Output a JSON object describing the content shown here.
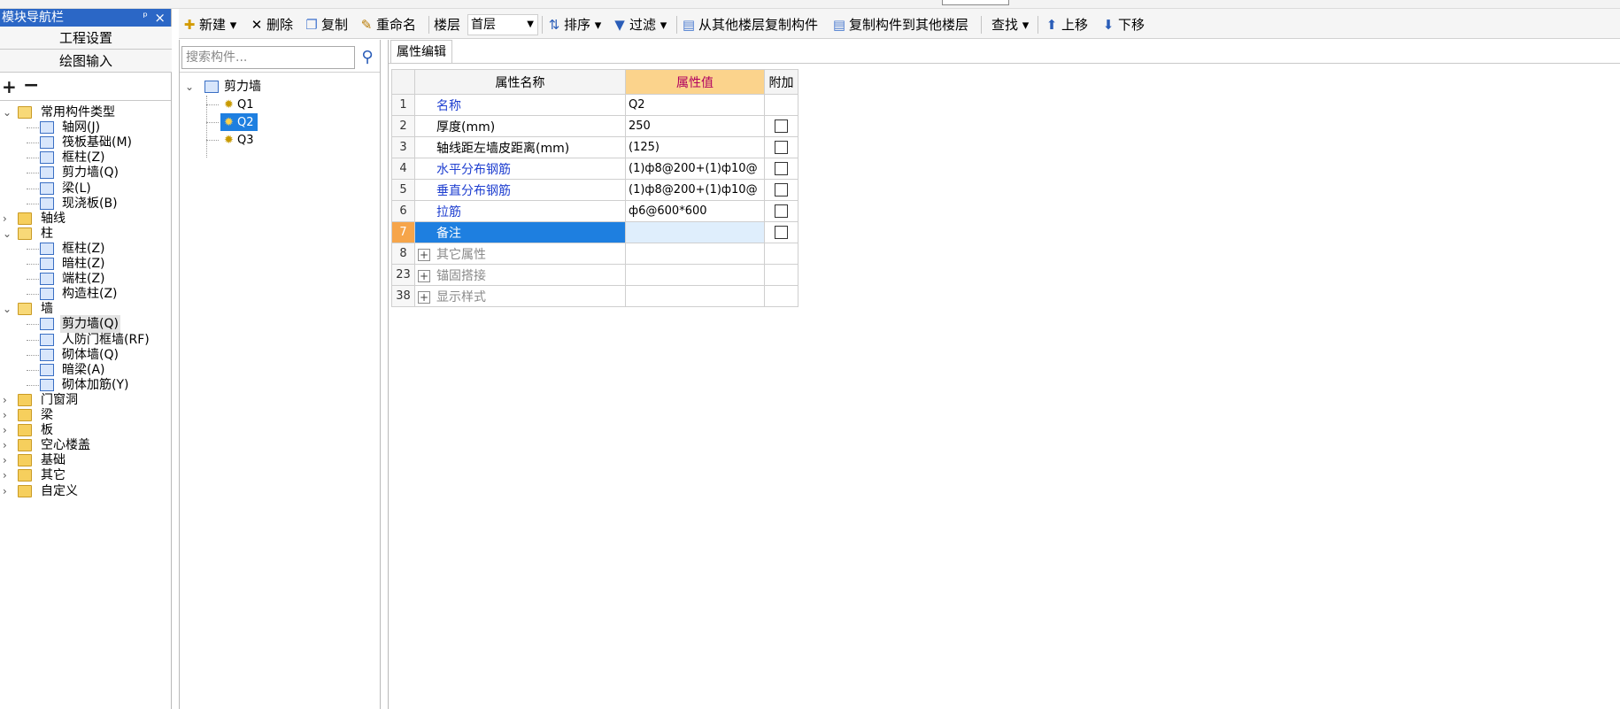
{
  "nav": {
    "title": "模块导航栏",
    "pin_icon": "pin-icon",
    "close_icon": "close-icon",
    "project_settings": "工程设置",
    "drawing_input": "绘图输入",
    "tree": [
      {
        "label": "常用构件类型",
        "type": "folder",
        "expanded": true
      },
      {
        "label": "轴网(J)",
        "type": "component"
      },
      {
        "label": "筏板基础(M)",
        "type": "component"
      },
      {
        "label": "框柱(Z)",
        "type": "component"
      },
      {
        "label": "剪力墙(Q)",
        "type": "component"
      },
      {
        "label": "梁(L)",
        "type": "component"
      },
      {
        "label": "现浇板(B)",
        "type": "component"
      },
      {
        "label": "轴线",
        "type": "folder",
        "expanded": false
      },
      {
        "label": "柱",
        "type": "folder",
        "expanded": true
      },
      {
        "label": "框柱(Z)",
        "type": "component"
      },
      {
        "label": "暗柱(Z)",
        "type": "component"
      },
      {
        "label": "端柱(Z)",
        "type": "component"
      },
      {
        "label": "构造柱(Z)",
        "type": "component"
      },
      {
        "label": "墙",
        "type": "folder",
        "expanded": true
      },
      {
        "label": "剪力墙(Q)",
        "type": "component",
        "selected": true
      },
      {
        "label": "人防门框墙(RF)",
        "type": "component"
      },
      {
        "label": "砌体墙(Q)",
        "type": "component"
      },
      {
        "label": "暗梁(A)",
        "type": "component"
      },
      {
        "label": "砌体加筋(Y)",
        "type": "component"
      },
      {
        "label": "门窗洞",
        "type": "folder",
        "expanded": false
      },
      {
        "label": "梁",
        "type": "folder",
        "expanded": false
      },
      {
        "label": "板",
        "type": "folder",
        "expanded": false
      },
      {
        "label": "空心楼盖",
        "type": "folder",
        "expanded": false
      },
      {
        "label": "基础",
        "type": "folder",
        "expanded": false
      },
      {
        "label": "其它",
        "type": "folder",
        "expanded": false
      },
      {
        "label": "自定义",
        "type": "folder",
        "expanded": false
      }
    ]
  },
  "toolbar": {
    "new": "新建",
    "delete": "删除",
    "copy": "复制",
    "rename": "重命名",
    "floor_label": "楼层",
    "floor_value": "首层",
    "sort": "排序",
    "filter": "过滤",
    "copy_from_floor": "从其他楼层复制构件",
    "copy_to_floor": "复制构件到其他楼层",
    "find": "查找",
    "move_up": "上移",
    "move_down": "下移"
  },
  "component_list": {
    "search_placeholder": "搜索构件...",
    "root": "剪力墙",
    "items": [
      "Q1",
      "Q2",
      "Q3"
    ],
    "selected": "Q2"
  },
  "property_editor": {
    "tab": "属性编辑",
    "headers": {
      "name": "属性名称",
      "value": "属性值",
      "extra": "附加"
    },
    "rows": [
      {
        "num": "1",
        "name": "名称",
        "value": "Q2",
        "style": "blue",
        "checkbox": false
      },
      {
        "num": "2",
        "name": "厚度(mm)",
        "value": "250",
        "style": "black",
        "checkbox": true
      },
      {
        "num": "3",
        "name": "轴线距左墙皮距离(mm)",
        "value": "(125)",
        "style": "black",
        "checkbox": true
      },
      {
        "num": "4",
        "name": "水平分布钢筋",
        "value": "(1)ф8@200+(1)ф10@",
        "style": "blue",
        "checkbox": true
      },
      {
        "num": "5",
        "name": "垂直分布钢筋",
        "value": "(1)ф8@200+(1)ф10@",
        "style": "blue",
        "checkbox": true
      },
      {
        "num": "6",
        "name": "拉筋",
        "value": "ф6@600*600",
        "style": "blue",
        "checkbox": true
      },
      {
        "num": "7",
        "name": "备注",
        "value": "",
        "style": "selected",
        "checkbox": true
      },
      {
        "num": "8",
        "name": "其它属性",
        "value": "",
        "style": "grey",
        "group": true
      },
      {
        "num": "23",
        "name": "锚固搭接",
        "value": "",
        "style": "grey",
        "group": true
      },
      {
        "num": "38",
        "name": "显示样式",
        "value": "",
        "style": "grey",
        "group": true
      }
    ]
  },
  "colors": {
    "title_bar": "#2b67c6",
    "selection": "#1e7fe0",
    "value_header": "#fbd38c",
    "row_active": "#f6a54a",
    "link_blue": "#1f3fd0"
  }
}
